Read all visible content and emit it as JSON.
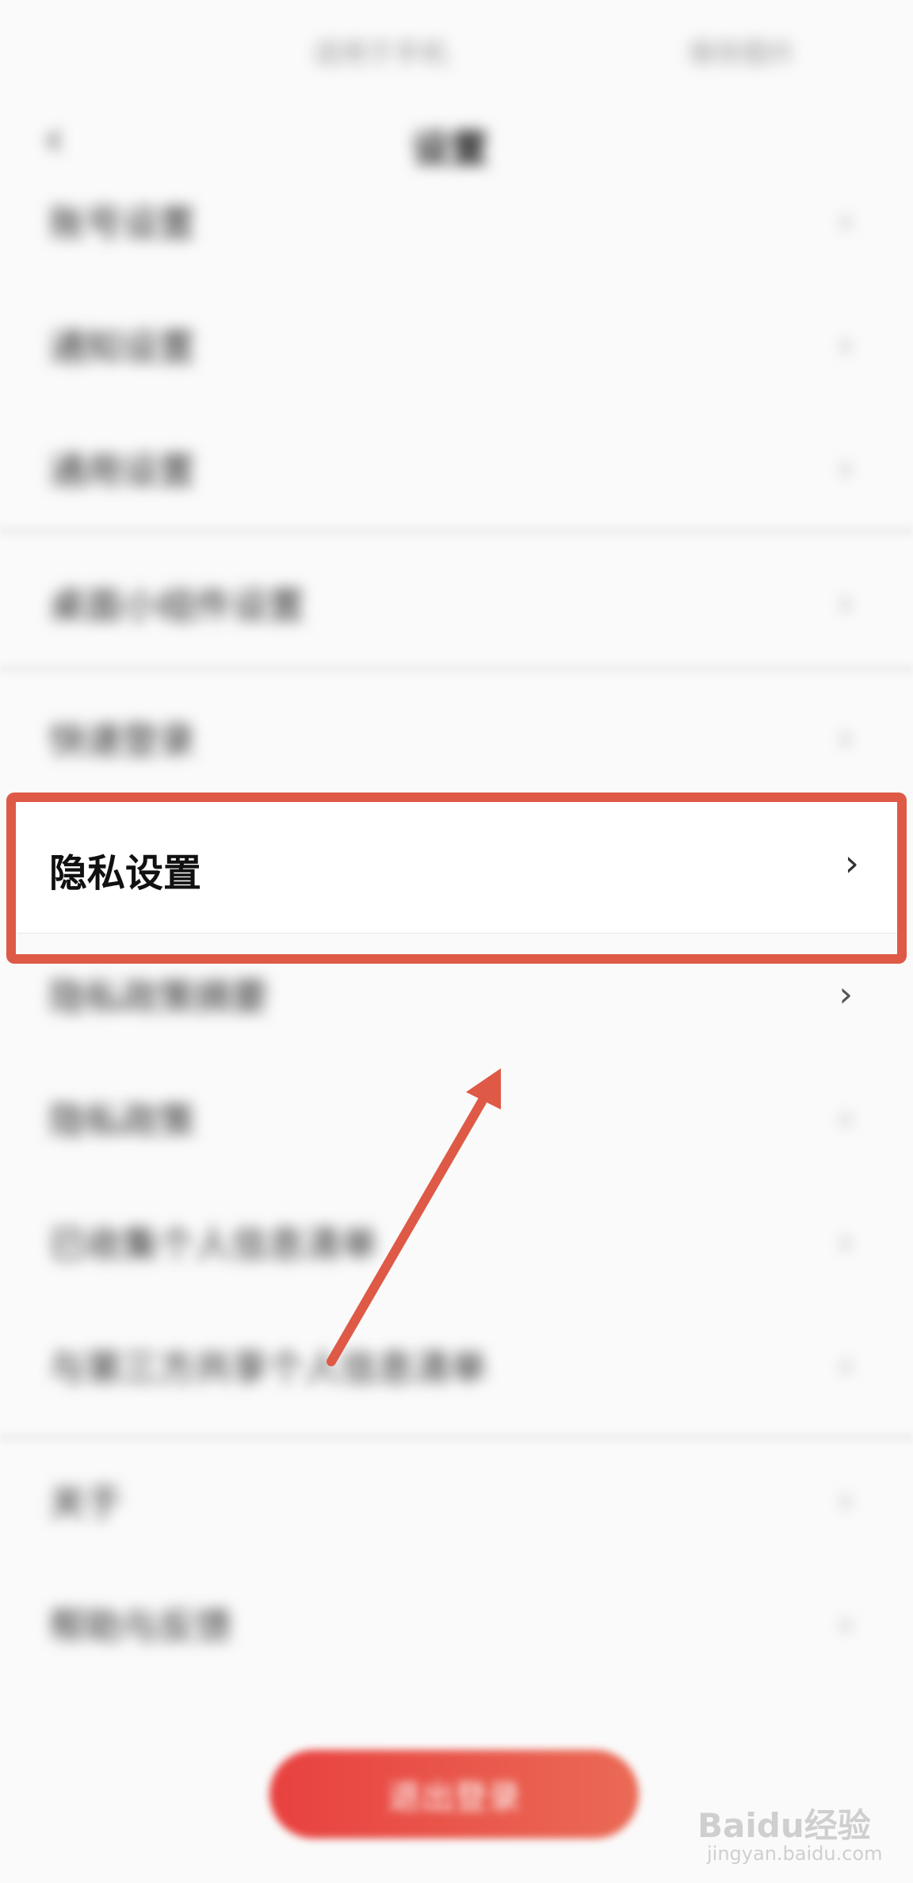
{
  "status_bar": {
    "center": "适用于手机",
    "right": "保存图片"
  },
  "nav": {
    "back_glyph": "‹",
    "title": "设置"
  },
  "rows": [
    {
      "label": "账号设置",
      "chevron": "›"
    },
    {
      "label": "通知设置",
      "chevron": "›"
    },
    {
      "label": "通用设置",
      "chevron": "›"
    },
    {
      "label": "桌面小组件设置",
      "chevron": "›"
    },
    {
      "label": "快速登录",
      "chevron": "›"
    },
    {
      "label": "隐私设置",
      "chevron": "›"
    },
    {
      "label": "隐私政策摘要",
      "chevron": "›"
    },
    {
      "label": "隐私政策",
      "chevron": "›"
    },
    {
      "label": "已收集个人信息清单",
      "chevron": "›"
    },
    {
      "label": "与第三方共享个人信息清单",
      "chevron": "›"
    },
    {
      "label": "关于",
      "chevron": "›"
    },
    {
      "label": "帮助与反馈",
      "chevron": "›"
    }
  ],
  "logout_button": {
    "label": "退出登录"
  },
  "watermark": {
    "brand": "Baidu经验",
    "url": "jingyan.baidu.com"
  },
  "colors": {
    "highlight": "#de5a46",
    "button_start": "#e8413f",
    "button_end": "#ea6a55"
  }
}
